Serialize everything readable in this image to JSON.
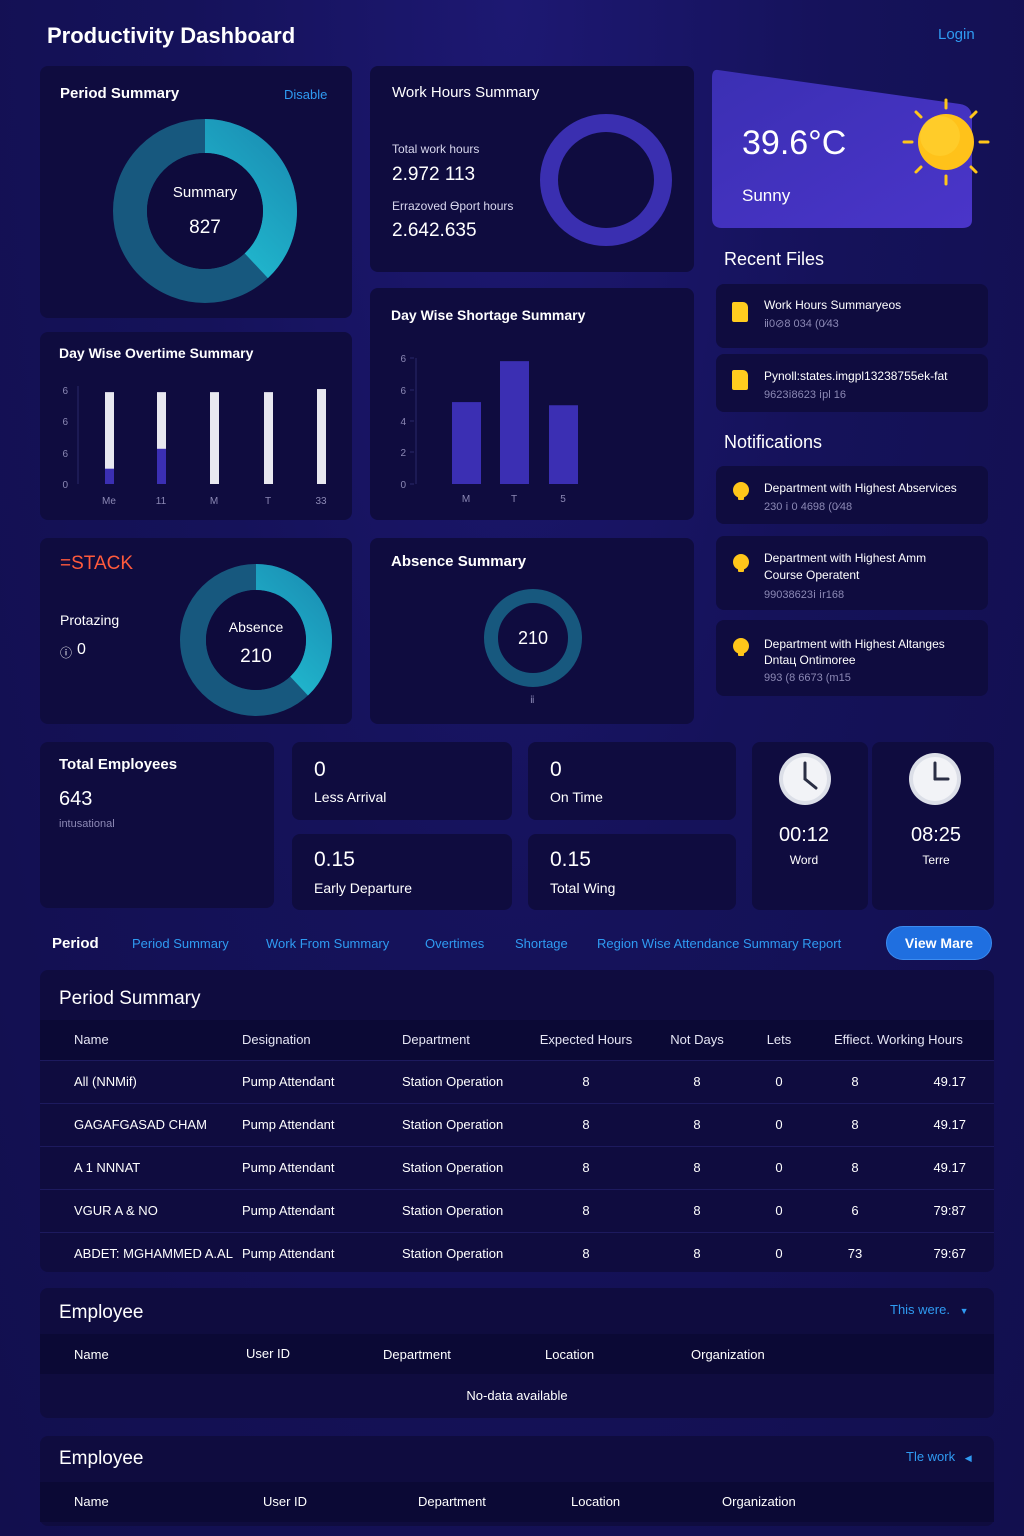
{
  "header": {
    "title": "Productivity Dashboard",
    "login": "Login"
  },
  "period_summary_card": {
    "title": "Period Summary",
    "action": "Disable",
    "donut_label": "Summary",
    "donut_value": "827"
  },
  "work_hours_card": {
    "title": "Work Hours Summary",
    "total_label": "Total work hours",
    "total_value": "2.972 113",
    "report_label": "Errazoved ϴport hours",
    "report_value": "2.642.635"
  },
  "weather": {
    "temperature": "39.6°C",
    "condition": "Sunny",
    "icon": "sun-icon"
  },
  "recent_files": {
    "title": "Recent Files",
    "items": [
      {
        "name": "Work Hours Summaryeos",
        "meta": "ⅱ0⊘8 034 (0⁄43"
      },
      {
        "name": "Pynoll:states.imgpl13238755ek-fat",
        "meta": "9623ⅰ8623 ⅰpl 16"
      }
    ]
  },
  "overtime_card": {
    "title": "Day Wise Overtime Summary",
    "y_ticks": [
      "6",
      "6",
      "6",
      "0"
    ],
    "x_labels": [
      "Me",
      "11",
      "M",
      "T",
      "33"
    ]
  },
  "shortage_card": {
    "title": "Day Wise Shortage Summary",
    "y_ticks": [
      "6",
      "6",
      "4",
      "2",
      "0"
    ],
    "x_labels": [
      "M",
      "T",
      "5"
    ]
  },
  "notifications": {
    "title": "Notifications",
    "items": [
      {
        "line1": "Department with Highest Abservices",
        "line2": "",
        "meta": "230 ⅰ 0 4698 (0⁄48"
      },
      {
        "line1": "Department with Highest Amm",
        "line2": "Course Operatent",
        "meta": "99038623ⅰ ⅰr168"
      },
      {
        "line1": "Department with Highest Altanges",
        "line2": "Dntaц Ontimoree",
        "meta": "993 (8 6673 (m15"
      }
    ]
  },
  "stack_card": {
    "brand": "=STACK",
    "label": "Protazing",
    "value": "0",
    "donut_label": "Absence",
    "donut_value": "210"
  },
  "absence_card": {
    "title": "Absence Summary",
    "donut_value": "210",
    "footnote": "ⅱ"
  },
  "employees_card": {
    "title": "Total Employees",
    "value": "643",
    "sub": "intusational"
  },
  "stats": [
    {
      "value": "0",
      "label": "Less Arrival"
    },
    {
      "value": "0",
      "label": "On Time"
    },
    {
      "value": "0.15",
      "label": "Early Departure"
    },
    {
      "value": "0.15",
      "label": "Total Wing"
    }
  ],
  "clocks": [
    {
      "time": "00:12",
      "label": "Word"
    },
    {
      "time": "08:25",
      "label": "Terre"
    }
  ],
  "tabs": {
    "label": "Period",
    "items": [
      "Period Summary",
      "Work From Summary",
      "Overtimes",
      "Shortage",
      "Region Wise Attendance Summary Report"
    ],
    "button": "View Mare"
  },
  "period_table": {
    "title": "Period Summary",
    "headers": [
      "Name",
      "Designation",
      "Department",
      "Expected Hours",
      "Not Days",
      "Lets",
      "Effiect. Working Hours",
      ""
    ],
    "rows": [
      [
        "All (NNMif)",
        "Pump Attendant",
        "Station Operation",
        "8",
        "8",
        "0",
        "8",
        "49.17"
      ],
      [
        "GAGAFGASAD CHAM",
        "Pump Attendant",
        "Station Operation",
        "8",
        "8",
        "0",
        "8",
        "49.17"
      ],
      [
        "A 1 NNNAT",
        "Pump Attendant",
        "Station Operation",
        "8",
        "8",
        "0",
        "8",
        "49.17"
      ],
      [
        "VGUR A & NO",
        "Pump Attendant",
        "Station Operation",
        "8",
        "8",
        "0",
        "6",
        "79:87"
      ],
      [
        "ABDET: MGHAMMED A.AL",
        "Pump Attendant",
        "Station Operation",
        "8",
        "8",
        "0",
        "73",
        "79:67"
      ]
    ]
  },
  "employee_table_1": {
    "title": "Employee",
    "filter": "This were.",
    "headers": [
      "Name",
      "User ID",
      "Department",
      "Location",
      "Organization"
    ],
    "empty": "No-data available"
  },
  "employee_table_2": {
    "title": "Employee",
    "filter": "Tle work",
    "headers": [
      "Name",
      "User ID",
      "Department",
      "Location",
      "Organization"
    ]
  },
  "chart_data": [
    {
      "type": "bar",
      "title": "Day Wise Overtime Summary",
      "categories": [
        "Me",
        "11",
        "M",
        "T",
        "33"
      ],
      "series": [
        {
          "values": [
            6,
            6,
            6,
            6,
            6.2
          ],
          "color": "#e8e8f0"
        },
        {
          "values": [
            1.0,
            2.3,
            0,
            0,
            0
          ],
          "color": "#3b2fb3"
        }
      ],
      "y_tick_labels": [
        "6",
        "6",
        "6",
        "0"
      ],
      "ylim": [
        0,
        6.4
      ]
    },
    {
      "type": "bar",
      "title": "Day Wise Shortage Summary",
      "categories": [
        "M",
        "T",
        "5"
      ],
      "values": [
        5.2,
        7.8,
        5.0
      ],
      "color": "#3b2fb3",
      "y_tick_labels": [
        "6",
        "6",
        "4",
        "2",
        "0"
      ],
      "ylim": [
        0,
        8
      ]
    },
    {
      "type": "pie",
      "title": "Period Summary",
      "values": [
        0.38,
        0.62
      ],
      "colors": [
        "#27c9d6",
        "#17587e"
      ]
    },
    {
      "type": "pie",
      "title": "Absence",
      "values": [
        0.38,
        0.62
      ],
      "colors": [
        "#27c9d6",
        "#17587e"
      ]
    },
    {
      "type": "pie",
      "title": "Absence Summary",
      "values": [
        1.0
      ],
      "colors": [
        "#17587e"
      ]
    },
    {
      "type": "pie",
      "title": "Work Hours Summary",
      "values": [
        1.0
      ],
      "colors": [
        "#3a2fb0"
      ]
    }
  ]
}
